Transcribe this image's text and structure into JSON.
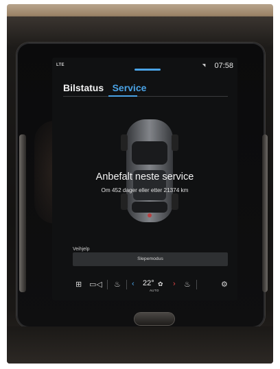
{
  "status": {
    "left": "LTE",
    "signal": "◥",
    "clock": "07:58"
  },
  "tabs": [
    {
      "label": "Bilstatus"
    },
    {
      "label": "Service"
    }
  ],
  "service": {
    "title": "Anbefalt neste service",
    "subtitle": "Om 452 dager eller etter 21374 km"
  },
  "roadside": {
    "label": "Veihjelp",
    "button": "Slepemodus"
  },
  "climate": {
    "temperature": "22°",
    "mode": "AUTO",
    "fan_glyph": "✿"
  },
  "colors": {
    "accent": "#4aa3e6",
    "warning": "#e54646"
  }
}
